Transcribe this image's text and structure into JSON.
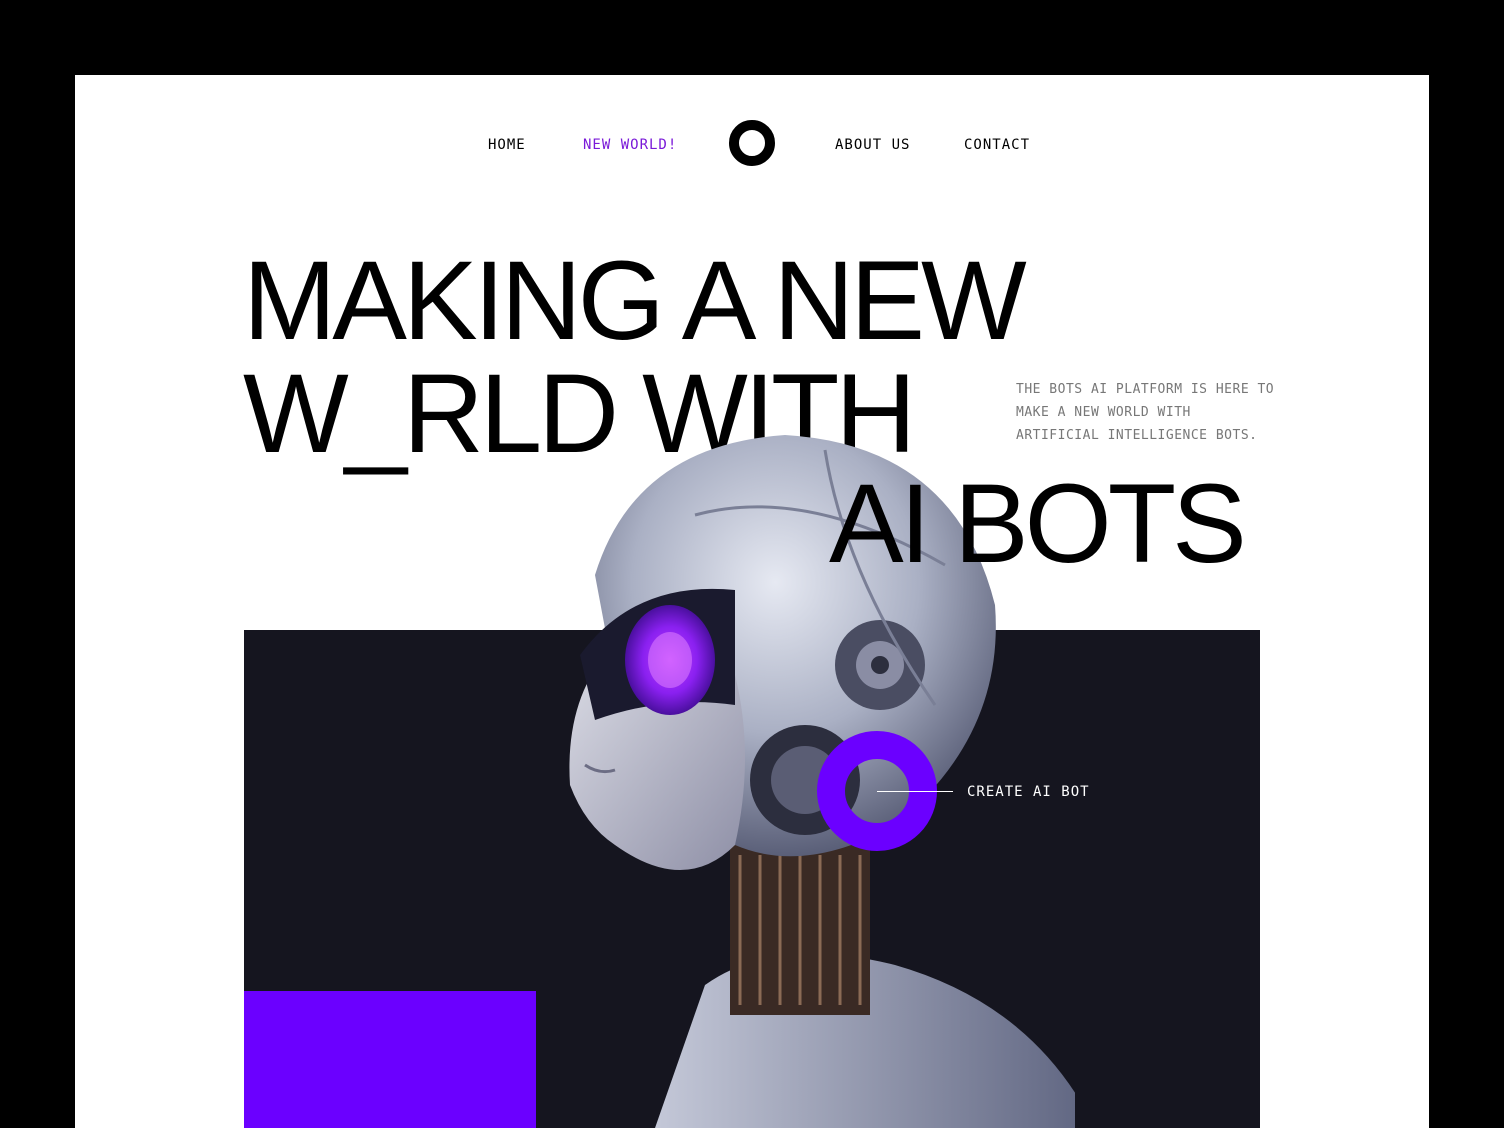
{
  "nav": {
    "items": [
      {
        "label": "HOME"
      },
      {
        "label": "NEW WORLD!"
      },
      {
        "label": "ABOUT US"
      },
      {
        "label": "CONTACT"
      }
    ]
  },
  "hero": {
    "headline_line1": "MAKING A NEW",
    "headline_line2": "W_RLD WITH",
    "headline_line3": "AI BOTS",
    "tagline": "THE BOTS AI PLATFORM IS HERE TO MAKE A NEW WORLD WITH ARTIFICIAL INTELLIGENCE BOTS.",
    "cta_label": "CREATE AI BOT"
  },
  "colors": {
    "accent": "#6b00ff",
    "nav_active": "#7a1ad8",
    "hero_background": "#15151f",
    "frame_background": "#ffffff",
    "outer_background": "#000000"
  },
  "icons": {
    "logo": "ring-logo-icon",
    "cta": "ring-cta-icon"
  }
}
